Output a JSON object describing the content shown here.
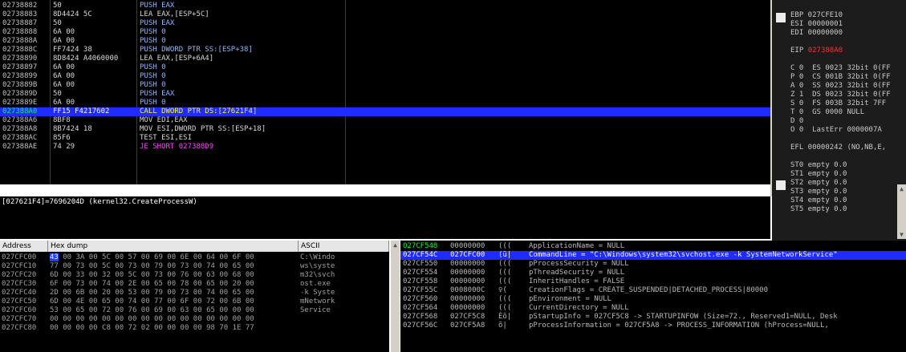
{
  "disasm": {
    "rows": [
      {
        "addr": "02738882",
        "hex": "50",
        "asm": "PUSH EAX",
        "kind": "push"
      },
      {
        "addr": "02738883",
        "hex": "8D4424 5C",
        "asm": "LEA EAX,[ESP+5C]",
        "kind": ""
      },
      {
        "addr": "02738887",
        "hex": "50",
        "asm": "PUSH EAX",
        "kind": "push"
      },
      {
        "addr": "02738888",
        "hex": "6A 00",
        "asm": "PUSH 0",
        "kind": "push"
      },
      {
        "addr": "0273888A",
        "hex": "6A 00",
        "asm": "PUSH 0",
        "kind": "push"
      },
      {
        "addr": "0273888C",
        "hex": "FF7424 38",
        "asm": "PUSH DWORD PTR SS:[ESP+38]",
        "kind": "push"
      },
      {
        "addr": "02738890",
        "hex": "8D8424 A4060000",
        "asm": "LEA EAX,[ESP+6A4]",
        "kind": ""
      },
      {
        "addr": "02738897",
        "hex": "6A 00",
        "asm": "PUSH 0",
        "kind": "push"
      },
      {
        "addr": "02738899",
        "hex": "6A 00",
        "asm": "PUSH 0",
        "kind": "push"
      },
      {
        "addr": "0273889B",
        "hex": "6A 00",
        "asm": "PUSH 0",
        "kind": "push"
      },
      {
        "addr": "0273889D",
        "hex": "50",
        "asm": "PUSH EAX",
        "kind": "push"
      },
      {
        "addr": "0273889E",
        "hex": "6A 00",
        "asm": "PUSH 0",
        "kind": "push"
      },
      {
        "addr": "027388A0",
        "hex": "FF15 F4217602",
        "asm": "CALL DWORD PTR DS:[27621F4]",
        "kind": "sel"
      },
      {
        "addr": "027388A6",
        "hex": "8BF8",
        "asm": "MOV EDI,EAX",
        "kind": ""
      },
      {
        "addr": "027388A8",
        "hex": "8B7424 18",
        "asm": "MOV ESI,DWORD PTR SS:[ESP+18]",
        "kind": ""
      },
      {
        "addr": "027388AC",
        "hex": "85F6",
        "asm": "TEST ESI,ESI",
        "kind": ""
      },
      {
        "addr": "027388AE",
        "hex": "74 29",
        "asm": "JE SHORT 027388D9",
        "kind": "jmp"
      }
    ],
    "info_line": "[027621F4]=7696204D (kernel32.CreateProcessW)"
  },
  "registers": {
    "lines": [
      "EBP 027CFE10",
      "ESI 00000001",
      "EDI 00000000",
      "",
      "EIP 027388A0",
      "",
      "C 0  ES 0023 32bit 0(FF",
      "P 0  CS 001B 32bit 0(FF",
      "A 0  SS 0023 32bit 0(FF",
      "Z 1  DS 0023 32bit 0(FF",
      "S 0  FS 003B 32bit 7FF",
      "T 0  GS 0000 NULL",
      "D 0",
      "O 0  LastErr 0000007A",
      "",
      "EFL 00000242 (NO,NB,E,",
      "",
      "ST0 empty 0.0",
      "ST1 empty 0.0",
      "ST2 empty 0.0",
      "ST3 empty 0.0",
      "ST4 empty 0.0",
      "ST5 empty 0.0"
    ],
    "eip_color": "#ff3030"
  },
  "dump": {
    "headers": {
      "address": "Address",
      "hex": "Hex dump",
      "ascii": "ASCII"
    },
    "rows": [
      {
        "addr": "027CFC00",
        "first": "43",
        "hex": " 00 3A 00 5C 00 57 00 69 00 6E 00 64 00 6F 00",
        "ascii": "C:\\Windo"
      },
      {
        "addr": "027CFC10",
        "first": "",
        "hex": "77 00 73 00 5C 00 73 00 79 00 73 00 74 00 65 00",
        "ascii": "ws\\syste"
      },
      {
        "addr": "027CFC20",
        "first": "",
        "hex": "6D 00 33 00 32 00 5C 00 73 00 76 00 63 00 68 00",
        "ascii": "m32\\svch"
      },
      {
        "addr": "027CFC30",
        "first": "",
        "hex": "6F 00 73 00 74 00 2E 00 65 00 78 00 65 00 20 00",
        "ascii": "ost.exe "
      },
      {
        "addr": "027CFC40",
        "first": "",
        "hex": "2D 00 6B 00 20 00 53 00 79 00 73 00 74 00 65 00",
        "ascii": "-k Syste"
      },
      {
        "addr": "027CFC50",
        "first": "",
        "hex": "6D 00 4E 00 65 00 74 00 77 00 6F 00 72 00 6B 00",
        "ascii": "mNetwork"
      },
      {
        "addr": "027CFC60",
        "first": "",
        "hex": "53 00 65 00 72 00 76 00 69 00 63 00 65 00 00 00",
        "ascii": "Service"
      },
      {
        "addr": "027CFC70",
        "first": "",
        "hex": "00 00 00 00 00 00 00 00 00 00 00 00 00 00 00 00",
        "ascii": ""
      },
      {
        "addr": "027CFC80",
        "first": "",
        "hex": "00 00 00 00 C8 00 72 02 00 00 00 00 98 70 1E 77",
        "ascii": ""
      }
    ]
  },
  "stack": {
    "rows": [
      {
        "a": "027CF548",
        "v": "00000000",
        "c": "(((",
        "t": "ApplicationName = NULL",
        "sel": false,
        "top": true
      },
      {
        "a": "027CF54C",
        "v": "027CFC00",
        "c": "(ü|",
        "t": "CommandLine = \"C:\\Windows\\system32\\svchost.exe -k SystemNetworkService\"",
        "sel": true,
        "top": false
      },
      {
        "a": "027CF550",
        "v": "00000000",
        "c": "(((",
        "t": "pProcessSecurity = NULL",
        "sel": false,
        "top": false
      },
      {
        "a": "027CF554",
        "v": "00000000",
        "c": "(((",
        "t": "pThreadSecurity = NULL",
        "sel": false,
        "top": false
      },
      {
        "a": "027CF558",
        "v": "00000000",
        "c": "(((",
        "t": "InheritHandles = FALSE",
        "sel": false,
        "top": false
      },
      {
        "a": "027CF55C",
        "v": "0008000C",
        "c": "♀(",
        "t": "CreationFlags = CREATE_SUSPENDED|DETACHED_PROCESS|80000",
        "sel": false,
        "top": false
      },
      {
        "a": "027CF560",
        "v": "00000000",
        "c": "(((",
        "t": "pEnvironment = NULL",
        "sel": false,
        "top": false
      },
      {
        "a": "027CF564",
        "v": "00000000",
        "c": "(((",
        "t": "CurrentDirectory = NULL",
        "sel": false,
        "top": false
      },
      {
        "a": "027CF568",
        "v": "027CF5C8",
        "c": "Èõ|",
        "t": "pStartupInfo = 027CF5C8 -> STARTUPINFOW (Size=72., Reserved1=NULL, Desk",
        "sel": false,
        "top": false
      },
      {
        "a": "027CF56C",
        "v": "027CF5A8",
        "c": "õ|",
        "t": "pProcessInformation = 027CF5A8 -> PROCESS_INFORMATION (hProcess=NULL,",
        "sel": false,
        "top": false
      }
    ]
  }
}
